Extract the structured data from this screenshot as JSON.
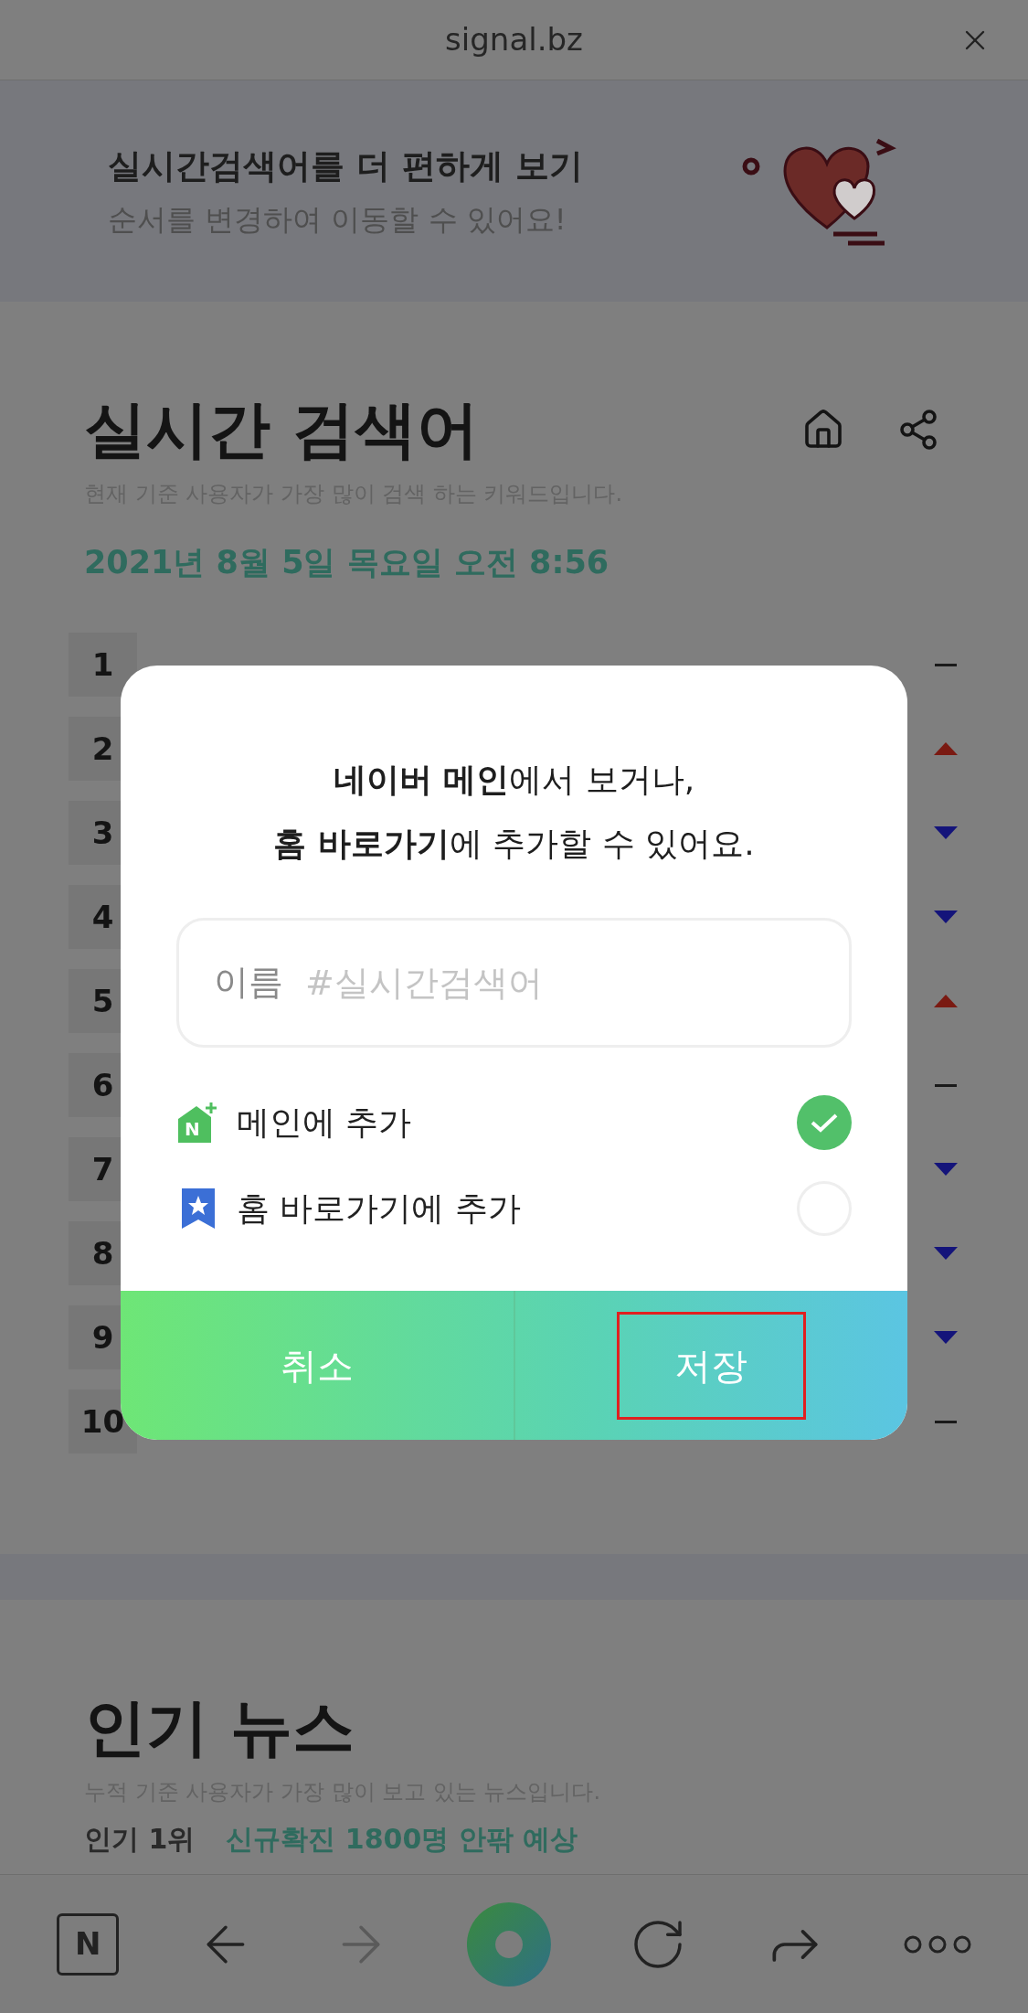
{
  "browser_bar": {
    "title": "signal.bz"
  },
  "banner": {
    "title": "실시간검색어를 더 편하게 보기",
    "subtitle": "순서를 변경하여 이동할 수 있어요!"
  },
  "realtime": {
    "title": "실시간 검색어",
    "description": "현재 기준 사용자가 가장 많이 검색 하는 키워드입니다.",
    "date": "2021년 8월 5일 목요일 오전 8:56",
    "rows": [
      {
        "rank": "1",
        "kind": "same"
      },
      {
        "rank": "2",
        "kind": "up"
      },
      {
        "rank": "3",
        "kind": "down"
      },
      {
        "rank": "4",
        "kind": "down"
      },
      {
        "rank": "5",
        "kind": "up"
      },
      {
        "rank": "6",
        "kind": "same"
      },
      {
        "rank": "7",
        "kind": "down"
      },
      {
        "rank": "8",
        "kind": "down"
      },
      {
        "rank": "9",
        "kind": "down"
      },
      {
        "rank": "10",
        "kind": "same"
      }
    ]
  },
  "dialog": {
    "message": [
      "**네이버 메인**에서 보거나,",
      "**홈 바로가기**에 추가할 수 있어요."
    ],
    "name_field": {
      "label": "이름",
      "placeholder": "#실시간검색어"
    },
    "options": [
      {
        "kind": "main",
        "badge": "N",
        "label": "메인에 추가",
        "checked": true
      },
      {
        "kind": "bookmark",
        "label": "홈 바로가기에 추가",
        "checked": false
      }
    ],
    "buttons": [
      {
        "label": "취소",
        "highlighted": false
      },
      {
        "label": "저장",
        "highlighted": true
      }
    ]
  },
  "news": {
    "title": "인기 뉴스",
    "description": "누적 기준 사용자가 가장 많이 보고 있는 뉴스입니다.",
    "items": [
      {
        "rank": "인기 1위",
        "headline": "신규확진 1800명 안팎 예상"
      }
    ]
  },
  "toolbar": [
    {
      "kind": "naver",
      "label": "N"
    },
    {
      "kind": "back",
      "disabled": false
    },
    {
      "kind": "forward",
      "disabled": true
    },
    {
      "kind": "whale"
    },
    {
      "kind": "reload",
      "disabled": false
    },
    {
      "kind": "share",
      "disabled": false
    },
    {
      "kind": "more",
      "disabled": false
    }
  ]
}
